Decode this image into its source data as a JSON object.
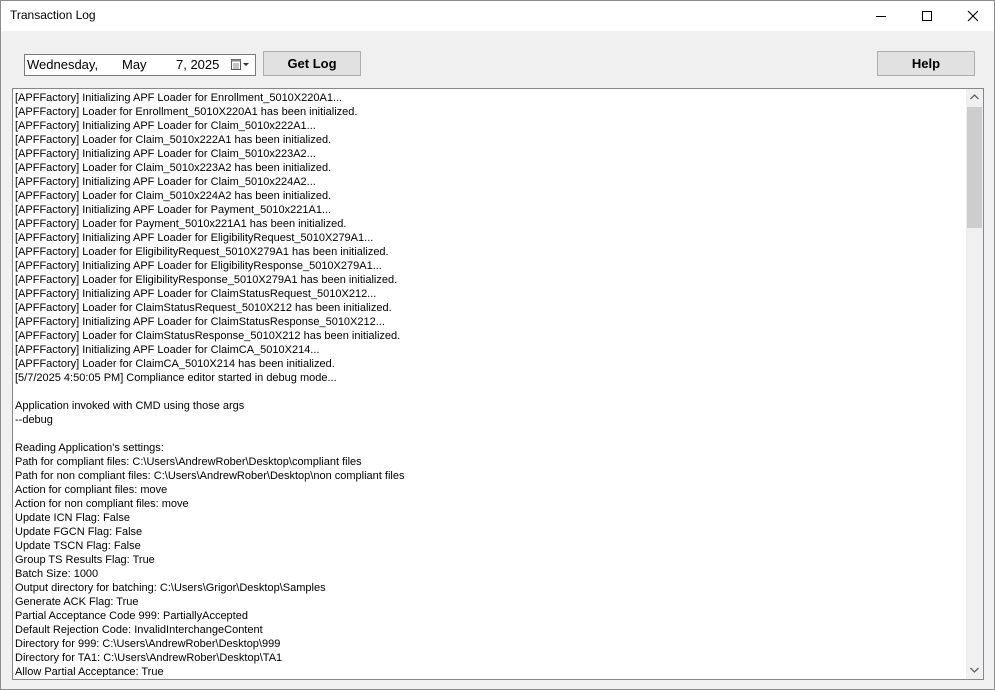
{
  "window": {
    "title": "Transaction Log"
  },
  "toolbar": {
    "date": {
      "day": "Wednesday,",
      "month": "May",
      "date": "7, 2025"
    },
    "get_log_label": "Get Log",
    "help_label": "Help"
  },
  "icons": {
    "minimize": "minimize-icon",
    "maximize": "maximize-icon",
    "close": "close-icon",
    "calendar": "calendar-dropdown-icon"
  },
  "log": {
    "lines": [
      "[APFFactory] Initializing APF Loader for Enrollment_5010X220A1...",
      "[APFFactory] Loader for Enrollment_5010X220A1 has been initialized.",
      "[APFFactory] Initializing APF Loader for Claim_5010x222A1...",
      "[APFFactory] Loader for Claim_5010x222A1 has been initialized.",
      "[APFFactory] Initializing APF Loader for Claim_5010x223A2...",
      "[APFFactory] Loader for Claim_5010x223A2 has been initialized.",
      "[APFFactory] Initializing APF Loader for Claim_5010x224A2...",
      "[APFFactory] Loader for Claim_5010x224A2 has been initialized.",
      "[APFFactory] Initializing APF Loader for Payment_5010x221A1...",
      "[APFFactory] Loader for Payment_5010x221A1 has been initialized.",
      "[APFFactory] Initializing APF Loader for EligibilityRequest_5010X279A1...",
      "[APFFactory] Loader for EligibilityRequest_5010X279A1 has been initialized.",
      "[APFFactory] Initializing APF Loader for EligibilityResponse_5010X279A1...",
      "[APFFactory] Loader for EligibilityResponse_5010X279A1 has been initialized.",
      "[APFFactory] Initializing APF Loader for ClaimStatusRequest_5010X212...",
      "[APFFactory] Loader for ClaimStatusRequest_5010X212 has been initialized.",
      "[APFFactory] Initializing APF Loader for ClaimStatusResponse_5010X212...",
      "[APFFactory] Loader for ClaimStatusResponse_5010X212 has been initialized.",
      "[APFFactory] Initializing APF Loader for ClaimCA_5010X214...",
      "[APFFactory] Loader for ClaimCA_5010X214 has been initialized.",
      "[5/7/2025 4:50:05 PM] Compliance editor started in debug mode...",
      "",
      "Application invoked with CMD using those args",
      "--debug",
      "",
      "Reading Application's settings:",
      "Path for compliant files: C:\\Users\\AndrewRober\\Desktop\\compliant files",
      "Path for non compliant files: C:\\Users\\AndrewRober\\Desktop\\non compliant files",
      "Action for compliant files: move",
      "Action for non compliant files: move",
      "Update ICN Flag: False",
      "Update FGCN Flag: False",
      "Update TSCN Flag: False",
      "Group TS Results Flag: True",
      "Batch Size: 1000",
      "Output directory for batching: C:\\Users\\Grigor\\Desktop\\Samples",
      "Generate ACK Flag: True",
      "Partial Acceptance Code 999: PartiallyAccepted",
      "Default Rejection Code: InvalidInterchangeContent",
      "Directory for 999: C:\\Users\\AndrewRober\\Desktop\\999",
      "Directory for TA1: C:\\Users\\AndrewRober\\Desktop\\TA1",
      "Allow Partial Acceptance: True"
    ]
  }
}
